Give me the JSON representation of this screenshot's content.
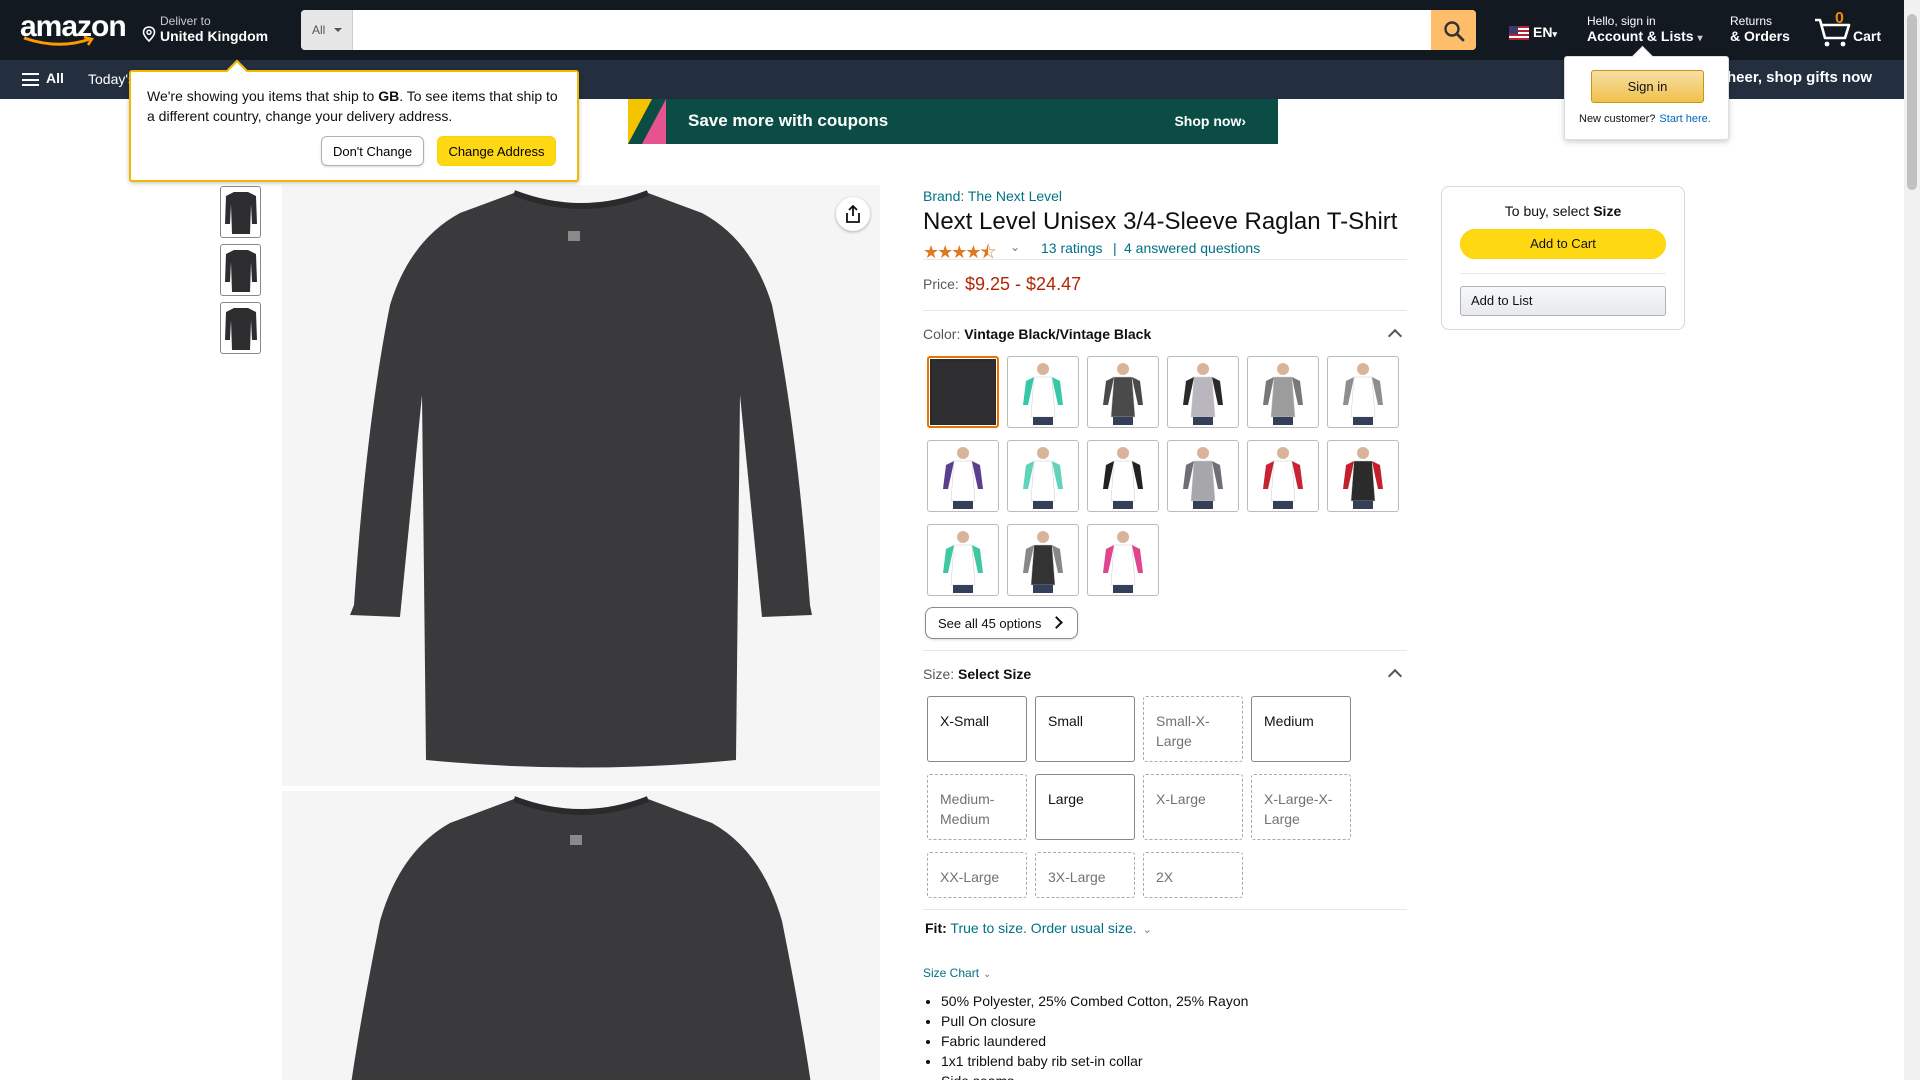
{
  "header": {
    "logo": "amazon",
    "deliver_to_label": "Deliver to",
    "deliver_to_location": "United Kingdom",
    "search_category": "All",
    "search_placeholder": "",
    "language": "EN",
    "account_greeting": "Hello, sign in",
    "account_label": "Account & Lists",
    "returns_label": "Returns",
    "orders_label": "& Orders",
    "cart_count": "0",
    "cart_label": "Cart"
  },
  "subnav": {
    "all_label": "All",
    "today_label": "Today's",
    "promo": "e cheer, shop gifts now"
  },
  "banner": {
    "text": "Save more with coupons",
    "cta": "Shop now›"
  },
  "location_popover": {
    "message_pre": "We're showing you items that ship to ",
    "country": "GB",
    "message_post": ". To see items that ship to a different country, change your delivery address.",
    "dont_change": "Don't Change",
    "change_address": "Change Address"
  },
  "signin_flyout": {
    "button": "Sign in",
    "new_customer": "New customer?",
    "start_here": "Start here."
  },
  "product": {
    "brand": "Brand: The Next Level",
    "title": "Next Level Unisex 3/4-Sleeve Raglan T-Shirt",
    "stars": "★★★★⯪",
    "rating_value": 4.5,
    "ratings": "13 ratings",
    "questions": "4 answered questions",
    "price_label": "Price:",
    "price": "$9.25 - $24.47"
  },
  "color": {
    "label": "Color: ",
    "selected": "Vintage Black/Vintage Black",
    "see_all": "See all 45 options",
    "swatches": [
      {
        "body": "#2f2f31",
        "sleeve": "#2f2f31",
        "bg": "#2b2b2d"
      },
      {
        "body": "#ffffff",
        "sleeve": "#37c9a7",
        "bg": "#ffffff"
      },
      {
        "body": "#4a4a4a",
        "sleeve": "#4a4a4a",
        "bg": "#ffffff"
      },
      {
        "body": "#b9b7bd",
        "sleeve": "#2a2a2a",
        "bg": "#ffffff"
      },
      {
        "body": "#9c9c9c",
        "sleeve": "#787878",
        "bg": "#ffffff"
      },
      {
        "body": "#ffffff",
        "sleeve": "#8e8e92",
        "bg": "#ffffff"
      },
      {
        "body": "#ffffff",
        "sleeve": "#5a3f8f",
        "bg": "#ffffff"
      },
      {
        "body": "#ffffff",
        "sleeve": "#5fd4b9",
        "bg": "#ffffff"
      },
      {
        "body": "#ffffff",
        "sleeve": "#222222",
        "bg": "#ffffff"
      },
      {
        "body": "#a7a6ab",
        "sleeve": "#6f6e76",
        "bg": "#ffffff"
      },
      {
        "body": "#ffffff",
        "sleeve": "#c62333",
        "bg": "#ffffff"
      },
      {
        "body": "#2b2b2b",
        "sleeve": "#c3202e",
        "bg": "#ffffff"
      },
      {
        "body": "#ffffff",
        "sleeve": "#3fc7a2",
        "bg": "#ffffff"
      },
      {
        "body": "#333333",
        "sleeve": "#888888",
        "bg": "#ffffff"
      },
      {
        "body": "#ffffff",
        "sleeve": "#e0468c",
        "bg": "#ffffff"
      }
    ]
  },
  "size": {
    "label": "Size: ",
    "selected": "Select Size",
    "options": [
      {
        "label": "X-Small",
        "available": true
      },
      {
        "label": "Small",
        "available": true
      },
      {
        "label": "Small-X-Large",
        "available": false
      },
      {
        "label": "Medium",
        "available": true
      },
      {
        "label": "Medium-Medium",
        "available": false
      },
      {
        "label": "Large",
        "available": true
      },
      {
        "label": "X-Large",
        "available": false
      },
      {
        "label": "X-Large-X-Large",
        "available": false
      },
      {
        "label": "XX-Large",
        "available": false
      },
      {
        "label": "3X-Large",
        "available": false
      },
      {
        "label": "2X",
        "available": false
      }
    ]
  },
  "fit": {
    "label": "Fit:",
    "value": "True to size. Order usual size."
  },
  "size_chart": "Size Chart",
  "bullets": [
    "50% Polyester, 25% Combed Cotton, 25% Rayon",
    "Pull On closure",
    "Fabric laundered",
    "1x1 triblend baby rib set-in collar",
    "Side seams"
  ],
  "buybox": {
    "to_buy_pre": "To buy, select ",
    "to_buy_field": "Size",
    "add_to_cart": "Add to Cart",
    "add_to_list": "Add to List"
  },
  "colors": {
    "nav_dark": "#131921",
    "nav_sub": "#232f3e",
    "accent_yellow": "#ffd814",
    "link": "#007185",
    "price": "#b12704",
    "selected_border": "#e77600"
  }
}
